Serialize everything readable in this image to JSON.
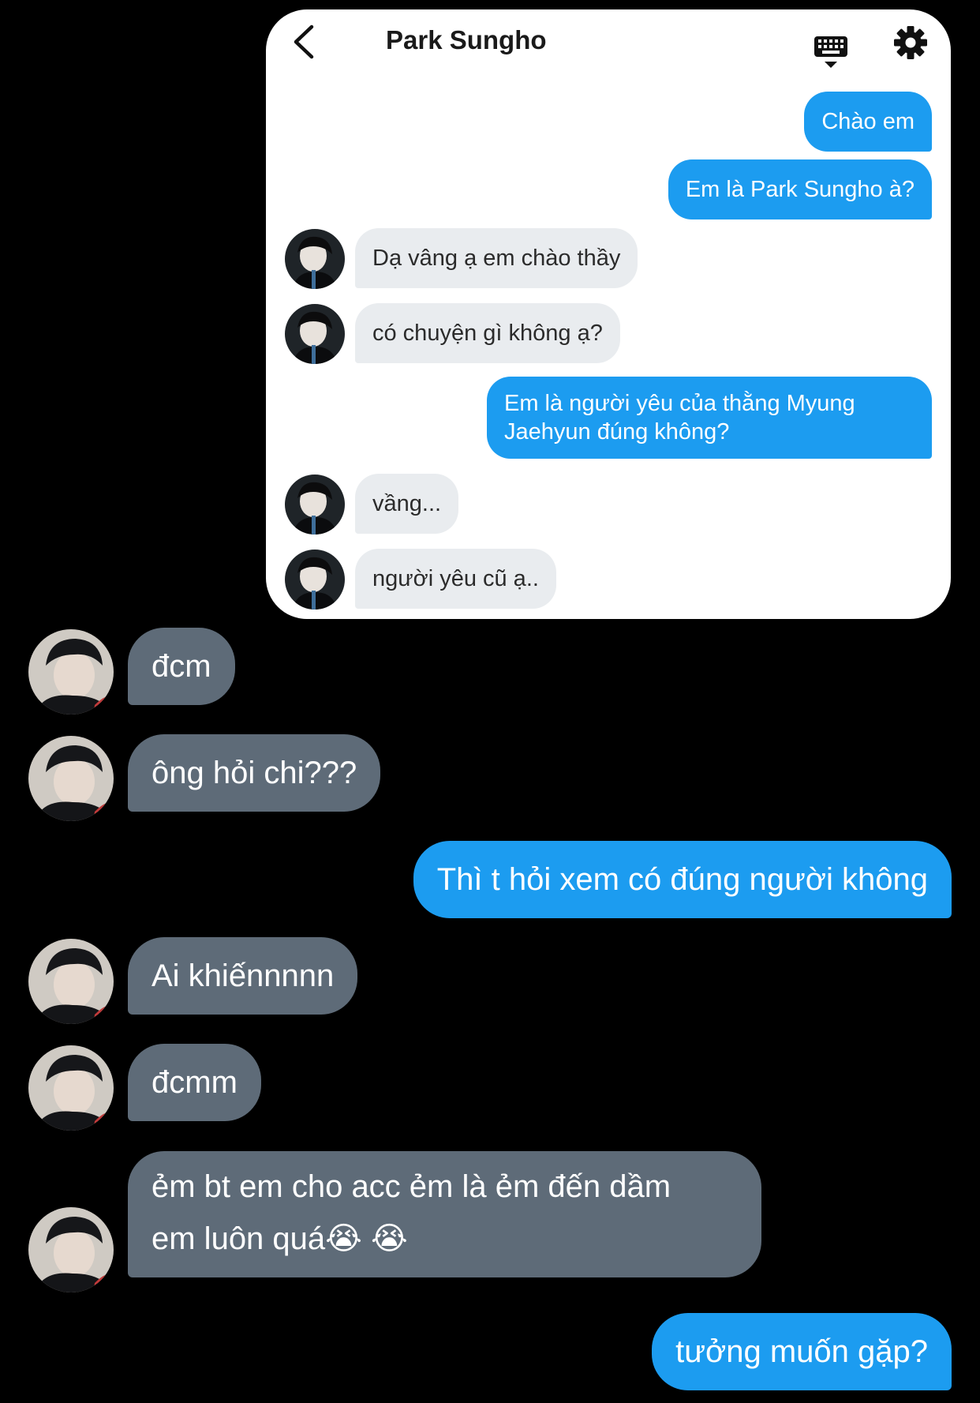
{
  "header": {
    "title": "Park Sungho",
    "back_icon": "chevron-left-icon",
    "keyboard_icon": "keyboard-icon",
    "settings_icon": "gear-icon"
  },
  "inner_messages": [
    {
      "from": "me",
      "text": "Chào em"
    },
    {
      "from": "me",
      "text": "Em là Park Sungho à?"
    },
    {
      "from": "them",
      "text": "Dạ vâng ạ em chào thầy"
    },
    {
      "from": "them",
      "text": "có chuyện gì không ạ?"
    },
    {
      "from": "me",
      "text": "Em là người yêu của thằng Myung",
      "text2": "Jaehyun đúng không?"
    },
    {
      "from": "them",
      "text": "vầng..."
    },
    {
      "from": "them",
      "text": "người yêu cũ ạ.."
    }
  ],
  "outer_messages": [
    {
      "from": "them",
      "text": "đcm"
    },
    {
      "from": "them",
      "text": "ông hỏi chi???"
    },
    {
      "from": "me",
      "text": "Thì t hỏi xem có đúng người không"
    },
    {
      "from": "them",
      "text": "Ai khiếnnnnn"
    },
    {
      "from": "them",
      "text": "đcmm"
    },
    {
      "from": "them",
      "text": "ẻm bt em cho acc ẻm là ẻm đến dầm",
      "text2": "em luôn quá😭 😭"
    },
    {
      "from": "me",
      "text": "tưởng muốn gặp?"
    }
  ],
  "colors": {
    "sent_bubble": "#1c9cf0",
    "inner_received_bubble": "#e9ecef",
    "outer_received_bubble": "#5e6b78",
    "background": "#000000",
    "card": "#ffffff"
  }
}
